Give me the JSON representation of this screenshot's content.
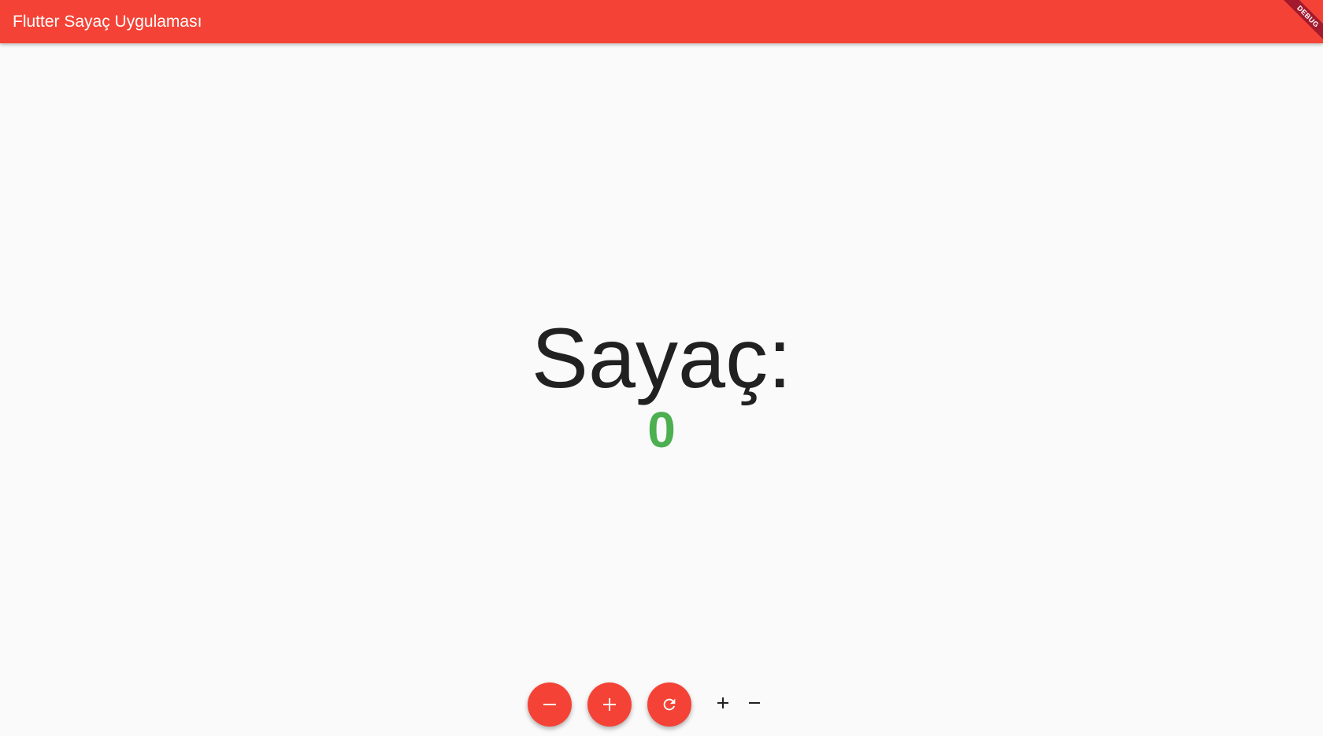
{
  "appbar": {
    "title": "Flutter Sayaç Uygulaması",
    "color": "#f44336",
    "debug_label": "DEBUG"
  },
  "counter": {
    "label": "Sayaç:",
    "value": "0",
    "value_color": "#4caf50"
  },
  "actions": [
    {
      "icon": "minus-icon"
    },
    {
      "icon": "plus-icon"
    },
    {
      "icon": "refresh-icon"
    },
    {
      "icon": "plus-icon"
    },
    {
      "icon": "minus-icon"
    }
  ]
}
